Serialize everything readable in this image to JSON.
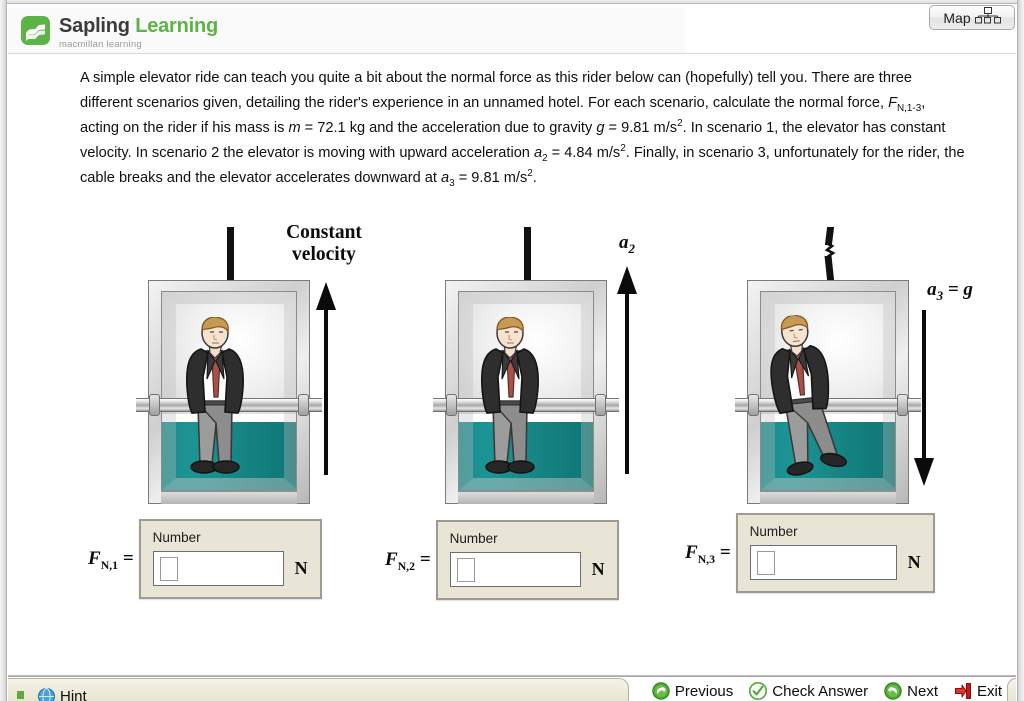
{
  "window": {
    "brand_green": "#5cb347",
    "teal": "#1a8b8b",
    "panel_beige": "#e8e5d6"
  },
  "header": {
    "logo_word_1": "Sapling",
    "logo_word_2": "Learning",
    "tagline": "macmillan learning",
    "logo_icon": "sapling-leaf-icon"
  },
  "map_button": {
    "label": "Map",
    "icon": "sitemap-icon"
  },
  "problem": {
    "p1_a": "A simple elevator ride can teach you quite a bit about the normal force as this rider below can (hopefully) tell you. There are three different scenarios given, detailing the rider's experience in an unnamed hotel. For each scenario, calculate the normal force, ",
    "force_symbol": "F",
    "force_sub": "N,1-3",
    "p1_b": ", acting on the rider if his mass is ",
    "mass_symbol": "m",
    "mass_value": " = 72.1 kg and the acceleration due to gravity ",
    "g_symbol": "g",
    "g_value": " = 9.81  m/s",
    "sup2_a": "2",
    "p1_c": ". In scenario 1, the elevator has constant velocity. In scenario 2 the elevator is moving with upward acceleration ",
    "a2_symbol": "a",
    "a2_sub": "2",
    "a2_value": " = 4.84 m/s",
    "sup2_b": "2",
    "p1_d": ". Finally, in scenario 3, unfortunately for the rider, the cable breaks and the elevator accelerates downward at ",
    "a3_symbol": "a",
    "a3_sub": "3",
    "a3_value": " = 9.81 m/s",
    "sup2_c": "2",
    "p1_e": "."
  },
  "scenarios": [
    {
      "id": "scenario-1",
      "caption_line1": "Constant",
      "caption_line2": "velocity",
      "caption_type": "text",
      "arrow_direction": "up",
      "cable_state": "intact",
      "rider_pose": "standing"
    },
    {
      "id": "scenario-2",
      "caption_symbol": "a",
      "caption_sub": "2",
      "caption_type": "math",
      "arrow_direction": "up",
      "cable_state": "intact",
      "rider_pose": "standing"
    },
    {
      "id": "scenario-3",
      "caption_symbol": "a",
      "caption_sub": "3",
      "caption_eq": " = ",
      "caption_rhs": "g",
      "caption_type": "math",
      "arrow_direction": "down",
      "cable_state": "broken",
      "rider_pose": "floating"
    }
  ],
  "answers": [
    {
      "id": "answer-1",
      "label_symbol": "F",
      "label_sub": "N,1",
      "label_eq": " =",
      "number_label": "Number",
      "value": "",
      "placeholder": "",
      "unit": "N"
    },
    {
      "id": "answer-2",
      "label_symbol": "F",
      "label_sub": "N,2",
      "label_eq": " =",
      "number_label": "Number",
      "value": "",
      "placeholder": "",
      "unit": "N"
    },
    {
      "id": "answer-3",
      "label_symbol": "F",
      "label_sub": "N,3",
      "label_eq": " =",
      "number_label": "Number",
      "value": "",
      "placeholder": "",
      "unit": "N"
    }
  ],
  "bottom_bar": {
    "hint_label": "Hint",
    "hint_icon": "hint-globe-icon",
    "actions": [
      {
        "label": "Previous",
        "icon": "arrow-left-circle-green-icon"
      },
      {
        "label": "Check Answer",
        "icon": "check-circle-green-icon"
      },
      {
        "label": "Next",
        "icon": "arrow-right-circle-green-icon"
      },
      {
        "label": "Exit",
        "icon": "exit-arrow-red-icon"
      }
    ]
  }
}
